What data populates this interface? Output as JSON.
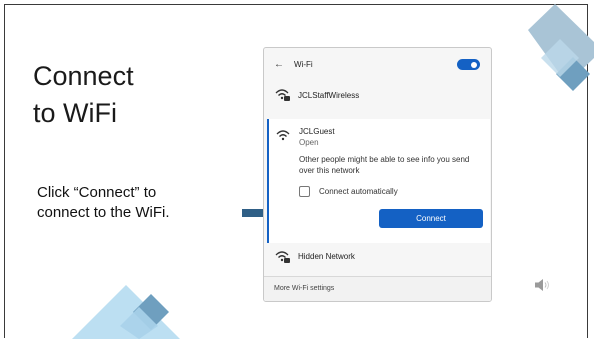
{
  "slide": {
    "title_line1": "Connect",
    "title_line2": "to WiFi",
    "instruction_line1": "Click “Connect” to",
    "instruction_line2": "connect to the WiFi."
  },
  "wifi_panel": {
    "back_icon": "back-arrow-icon",
    "title": "Wi-Fi",
    "toggle_on": true,
    "networks": [
      {
        "name": "JCLStaffWireless",
        "icon": "wifi-secured-icon"
      },
      {
        "name": "JCLGuest",
        "icon": "wifi-icon",
        "status": "Open"
      },
      {
        "name": "Hidden Network",
        "icon": "wifi-secured-icon"
      }
    ],
    "expanded": {
      "info": "Other people might be able to see info you send over this network",
      "auto_connect_label": "Connect automatically",
      "auto_connect_checked": false,
      "connect_label": "Connect"
    },
    "footer_link": "More Wi-Fi settings"
  },
  "colors": {
    "accent": "#1461c4",
    "arrow": "#2f5f86",
    "deco_dark": "#6f9fbf",
    "deco_light": "#bcdff2",
    "deco_grey": "#a9bdcc"
  }
}
